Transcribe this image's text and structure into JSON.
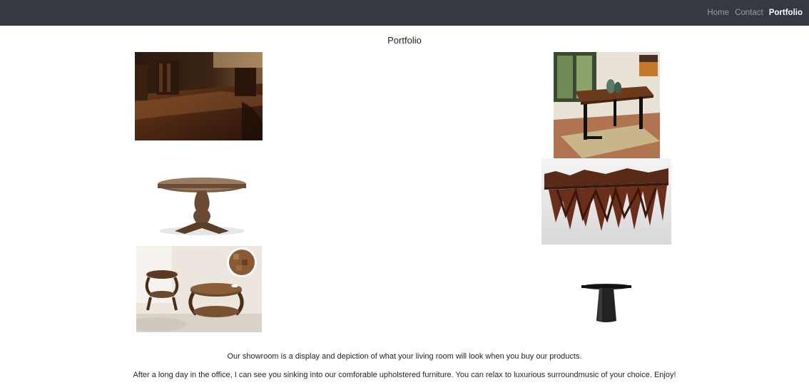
{
  "navbar": {
    "links": [
      {
        "label": "Home",
        "active": false
      },
      {
        "label": "Contact",
        "active": false
      },
      {
        "label": "Portfolio",
        "active": true
      }
    ],
    "background": "#343a40"
  },
  "page": {
    "title": "Portfolio",
    "paragraphs": [
      "Our showroom is a display and depiction of what your living room will look when you buy our products.",
      "After a long day in the office, I can see you sinking into our comforable upholstered furniture. You can relax to luxurious surroundmusic of your choice. Enjoy!"
    ]
  },
  "gallery": [
    {
      "name": "dining-table-closeup-photo"
    },
    {
      "name": "modern-dining-table-room-photo"
    },
    {
      "name": "round-pedestal-table-photo"
    },
    {
      "name": "sculptural-wood-table-photo"
    },
    {
      "name": "round-coffee-table-set-photo"
    },
    {
      "name": "black-side-table-photo"
    }
  ]
}
